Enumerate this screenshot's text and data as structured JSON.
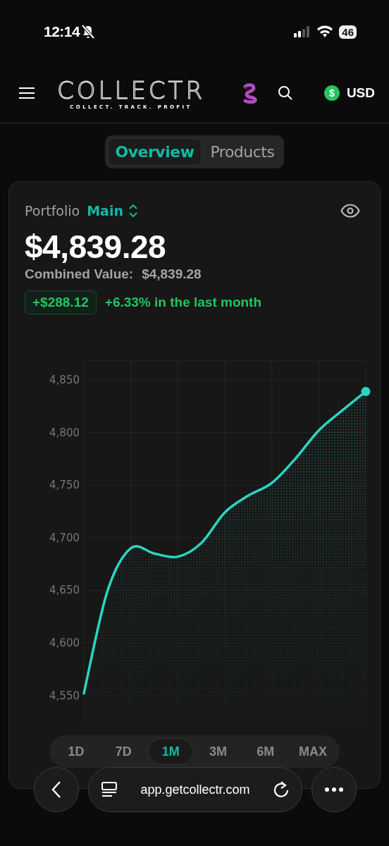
{
  "status_bar": {
    "time": "12:14",
    "silent": true,
    "battery": "46"
  },
  "header": {
    "logo": "COLLECTR",
    "tagline": "COLLECT. TRACK. PROFIT",
    "currency_symbol": "$",
    "currency": "USD"
  },
  "view_tabs": [
    {
      "label": "Overview",
      "selected": true
    },
    {
      "label": "Products",
      "selected": false
    }
  ],
  "portfolio": {
    "label": "Portfolio",
    "name": "Main",
    "value": "$4,839.28",
    "combined_label": "Combined Value:",
    "combined_value": "$4,839.28",
    "change_amount": "+$288.12",
    "change_text": "+6.33% in the last month",
    "chart_data": {
      "type": "area",
      "grid": true,
      "ylim": [
        4523,
        4868
      ],
      "yticks": [
        {
          "value": 4550,
          "label": "4,550"
        },
        {
          "value": 4600,
          "label": "4,600"
        },
        {
          "value": 4650,
          "label": "4,650"
        },
        {
          "value": 4700,
          "label": "4,700"
        },
        {
          "value": 4750,
          "label": "4,750"
        },
        {
          "value": 4800,
          "label": "4,800"
        },
        {
          "value": 4850,
          "label": "4,850"
        }
      ],
      "series": [
        {
          "color": "#2dd4bf",
          "values": [
            4552,
            4649,
            4690,
            4685,
            4682,
            4695,
            4724,
            4740,
            4752,
            4775,
            4802,
            4821,
            4839
          ]
        }
      ]
    },
    "ranges": [
      {
        "label": "1D",
        "selected": false
      },
      {
        "label": "7D",
        "selected": false
      },
      {
        "label": "1M",
        "selected": true
      },
      {
        "label": "3M",
        "selected": false
      },
      {
        "label": "6M",
        "selected": false
      },
      {
        "label": "MAX",
        "selected": false
      }
    ]
  },
  "browser_bar": {
    "url": "app.getcollectr.com"
  }
}
